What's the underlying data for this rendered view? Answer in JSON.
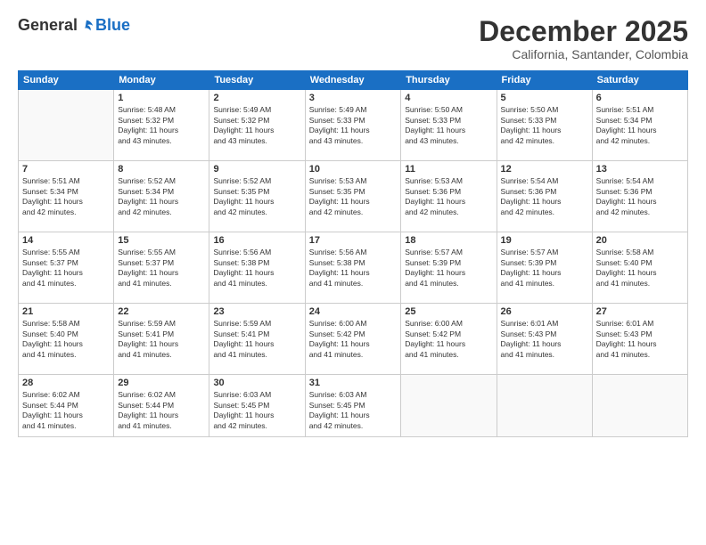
{
  "header": {
    "logo_general": "General",
    "logo_blue": "Blue",
    "month_title": "December 2025",
    "subtitle": "California, Santander, Colombia"
  },
  "days_of_week": [
    "Sunday",
    "Monday",
    "Tuesday",
    "Wednesday",
    "Thursday",
    "Friday",
    "Saturday"
  ],
  "weeks": [
    [
      {
        "day": "",
        "info": ""
      },
      {
        "day": "1",
        "info": "Sunrise: 5:48 AM\nSunset: 5:32 PM\nDaylight: 11 hours\nand 43 minutes."
      },
      {
        "day": "2",
        "info": "Sunrise: 5:49 AM\nSunset: 5:32 PM\nDaylight: 11 hours\nand 43 minutes."
      },
      {
        "day": "3",
        "info": "Sunrise: 5:49 AM\nSunset: 5:33 PM\nDaylight: 11 hours\nand 43 minutes."
      },
      {
        "day": "4",
        "info": "Sunrise: 5:50 AM\nSunset: 5:33 PM\nDaylight: 11 hours\nand 43 minutes."
      },
      {
        "day": "5",
        "info": "Sunrise: 5:50 AM\nSunset: 5:33 PM\nDaylight: 11 hours\nand 42 minutes."
      },
      {
        "day": "6",
        "info": "Sunrise: 5:51 AM\nSunset: 5:34 PM\nDaylight: 11 hours\nand 42 minutes."
      }
    ],
    [
      {
        "day": "7",
        "info": "Sunrise: 5:51 AM\nSunset: 5:34 PM\nDaylight: 11 hours\nand 42 minutes."
      },
      {
        "day": "8",
        "info": "Sunrise: 5:52 AM\nSunset: 5:34 PM\nDaylight: 11 hours\nand 42 minutes."
      },
      {
        "day": "9",
        "info": "Sunrise: 5:52 AM\nSunset: 5:35 PM\nDaylight: 11 hours\nand 42 minutes."
      },
      {
        "day": "10",
        "info": "Sunrise: 5:53 AM\nSunset: 5:35 PM\nDaylight: 11 hours\nand 42 minutes."
      },
      {
        "day": "11",
        "info": "Sunrise: 5:53 AM\nSunset: 5:36 PM\nDaylight: 11 hours\nand 42 minutes."
      },
      {
        "day": "12",
        "info": "Sunrise: 5:54 AM\nSunset: 5:36 PM\nDaylight: 11 hours\nand 42 minutes."
      },
      {
        "day": "13",
        "info": "Sunrise: 5:54 AM\nSunset: 5:36 PM\nDaylight: 11 hours\nand 42 minutes."
      }
    ],
    [
      {
        "day": "14",
        "info": "Sunrise: 5:55 AM\nSunset: 5:37 PM\nDaylight: 11 hours\nand 41 minutes."
      },
      {
        "day": "15",
        "info": "Sunrise: 5:55 AM\nSunset: 5:37 PM\nDaylight: 11 hours\nand 41 minutes."
      },
      {
        "day": "16",
        "info": "Sunrise: 5:56 AM\nSunset: 5:38 PM\nDaylight: 11 hours\nand 41 minutes."
      },
      {
        "day": "17",
        "info": "Sunrise: 5:56 AM\nSunset: 5:38 PM\nDaylight: 11 hours\nand 41 minutes."
      },
      {
        "day": "18",
        "info": "Sunrise: 5:57 AM\nSunset: 5:39 PM\nDaylight: 11 hours\nand 41 minutes."
      },
      {
        "day": "19",
        "info": "Sunrise: 5:57 AM\nSunset: 5:39 PM\nDaylight: 11 hours\nand 41 minutes."
      },
      {
        "day": "20",
        "info": "Sunrise: 5:58 AM\nSunset: 5:40 PM\nDaylight: 11 hours\nand 41 minutes."
      }
    ],
    [
      {
        "day": "21",
        "info": "Sunrise: 5:58 AM\nSunset: 5:40 PM\nDaylight: 11 hours\nand 41 minutes."
      },
      {
        "day": "22",
        "info": "Sunrise: 5:59 AM\nSunset: 5:41 PM\nDaylight: 11 hours\nand 41 minutes."
      },
      {
        "day": "23",
        "info": "Sunrise: 5:59 AM\nSunset: 5:41 PM\nDaylight: 11 hours\nand 41 minutes."
      },
      {
        "day": "24",
        "info": "Sunrise: 6:00 AM\nSunset: 5:42 PM\nDaylight: 11 hours\nand 41 minutes."
      },
      {
        "day": "25",
        "info": "Sunrise: 6:00 AM\nSunset: 5:42 PM\nDaylight: 11 hours\nand 41 minutes."
      },
      {
        "day": "26",
        "info": "Sunrise: 6:01 AM\nSunset: 5:43 PM\nDaylight: 11 hours\nand 41 minutes."
      },
      {
        "day": "27",
        "info": "Sunrise: 6:01 AM\nSunset: 5:43 PM\nDaylight: 11 hours\nand 41 minutes."
      }
    ],
    [
      {
        "day": "28",
        "info": "Sunrise: 6:02 AM\nSunset: 5:44 PM\nDaylight: 11 hours\nand 41 minutes."
      },
      {
        "day": "29",
        "info": "Sunrise: 6:02 AM\nSunset: 5:44 PM\nDaylight: 11 hours\nand 41 minutes."
      },
      {
        "day": "30",
        "info": "Sunrise: 6:03 AM\nSunset: 5:45 PM\nDaylight: 11 hours\nand 42 minutes."
      },
      {
        "day": "31",
        "info": "Sunrise: 6:03 AM\nSunset: 5:45 PM\nDaylight: 11 hours\nand 42 minutes."
      },
      {
        "day": "",
        "info": ""
      },
      {
        "day": "",
        "info": ""
      },
      {
        "day": "",
        "info": ""
      }
    ]
  ]
}
